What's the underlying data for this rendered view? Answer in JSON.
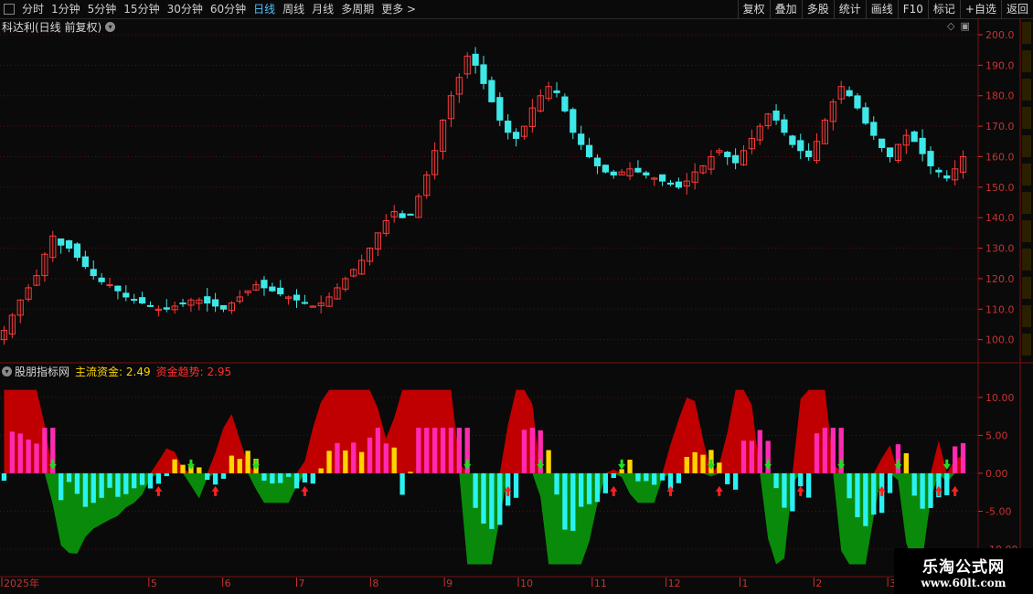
{
  "toolbar": {
    "periods": [
      "分时",
      "1分钟",
      "5分钟",
      "15分钟",
      "30分钟",
      "60分钟",
      "日线",
      "周线",
      "月线",
      "多周期",
      "更多 >"
    ],
    "active_period": "日线",
    "right_buttons": [
      "复权",
      "叠加",
      "多股",
      "统计",
      "画线",
      "F10",
      "标记",
      "+自选",
      "返回"
    ]
  },
  "main_chart": {
    "title": "科达利(日线 前复权)",
    "price_axis": [
      "200.0",
      "190.0",
      "180.0",
      "170.0",
      "160.0",
      "150.0",
      "140.0",
      "130.0",
      "120.0",
      "110.0",
      "100.0"
    ],
    "up_color": "#ff3a3a",
    "down_color": "#3fe8e8"
  },
  "indicator": {
    "name": "股朋指标网",
    "main_fund_label": "主流资金: 2.49",
    "fund_trend_label": "资金趋势: 2.95",
    "axis": [
      "10.00",
      "5.00",
      "0.00",
      "-5.00",
      "-10.00"
    ],
    "colors": {
      "trend_up": "#c00000",
      "trend_down": "#0a8a0a",
      "bar_up": "#ffd400",
      "bar_strong": "#ff2ab0",
      "bar_down": "#2af2f2"
    }
  },
  "dates": [
    "2025年",
    "5",
    "6",
    "7",
    "8",
    "9",
    "10",
    "11",
    "12",
    "1",
    "2",
    "3"
  ],
  "watermark": {
    "main": "乐淘公式网",
    "url": "www.60lt.com"
  },
  "chart_data": {
    "type": "candlestick",
    "title": "科达利(日线 前复权)",
    "ylim": [
      93,
      203
    ],
    "close_series_approx": [
      103,
      108,
      113,
      117,
      121,
      128,
      134,
      131,
      130,
      127,
      124,
      121,
      119,
      118,
      116,
      114,
      113,
      112,
      111,
      110,
      110,
      111,
      112,
      113,
      113,
      112,
      111,
      110,
      112,
      114,
      116,
      118,
      117,
      116,
      115,
      114,
      113,
      112,
      111,
      112,
      114,
      117,
      120,
      123,
      126,
      130,
      135,
      139,
      142,
      140,
      141,
      147,
      154,
      162,
      172,
      180,
      186,
      193,
      190,
      184,
      178,
      172,
      168,
      166,
      170,
      176,
      180,
      183,
      181,
      175,
      168,
      164,
      160,
      157,
      155,
      154,
      155,
      156,
      155,
      154,
      153,
      152,
      151,
      150,
      152,
      155,
      157,
      160,
      162,
      160,
      158,
      162,
      166,
      170,
      174,
      172,
      168,
      164,
      162,
      160,
      165,
      172,
      178,
      183,
      180,
      176,
      171,
      167,
      163,
      160,
      164,
      167,
      165,
      161,
      157,
      155,
      153,
      156,
      160
    ]
  }
}
